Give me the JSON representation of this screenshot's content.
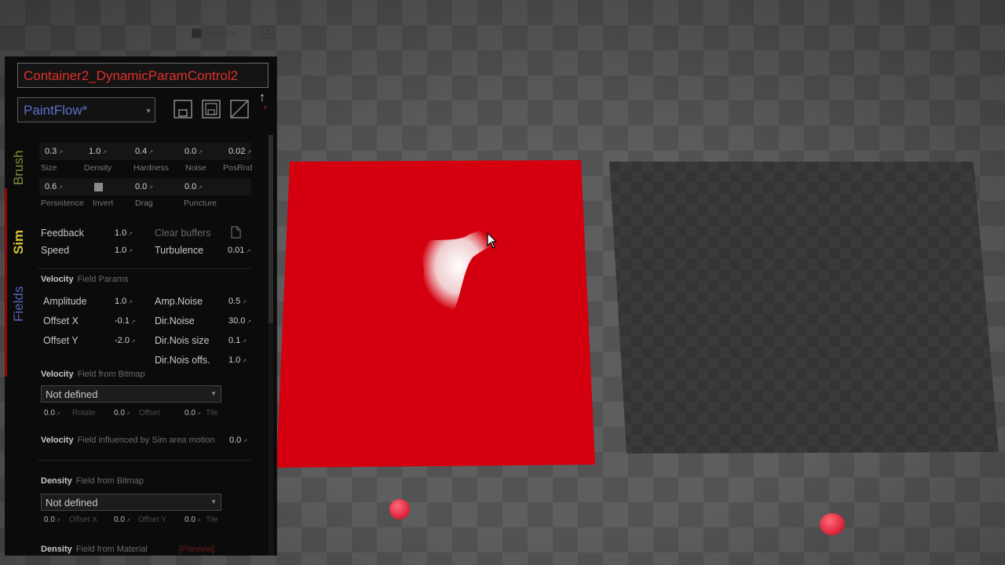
{
  "toolbar": {
    "v_label": "V",
    "tooltips_label": "Tooltips",
    "close_label": "X"
  },
  "panel": {
    "title": "Container2_DynamicParamControl2",
    "preset": "PaintFlow*",
    "tabs": {
      "brush": "Brush",
      "sim": "Sim",
      "fields": "Fields"
    }
  },
  "brush": {
    "row1": [
      {
        "value": "0.3",
        "label": "Size"
      },
      {
        "value": "1.0",
        "label": "Density"
      },
      {
        "value": "0.4",
        "label": "Hardness"
      },
      {
        "value": "0.0",
        "label": "Noise"
      },
      {
        "value": "0.02",
        "label": "PosRnd"
      }
    ],
    "row2": [
      {
        "value": "0.6",
        "label": "Persistence"
      },
      {
        "label": "Invert"
      },
      {
        "value": "0.0",
        "label": "Drag"
      },
      {
        "value": "0.0",
        "label": "Puncture"
      }
    ]
  },
  "sim": {
    "feedback": {
      "label": "Feedback",
      "value": "1.0"
    },
    "speed": {
      "label": "Speed",
      "value": "1.0"
    },
    "clear_buffers": "Clear buffers",
    "turbulence": {
      "label": "Turbulence",
      "value": "0.01"
    }
  },
  "velocity_params": {
    "title": "Velocity",
    "subtitle": "Field Params",
    "amplitude": {
      "label": "Amplitude",
      "value": "1.0"
    },
    "offset_x": {
      "label": "Offset X",
      "value": "-0.1"
    },
    "offset_y": {
      "label": "Offset Y",
      "value": "-2.0"
    },
    "amp_noise": {
      "label": "Amp.Noise",
      "value": "0.5"
    },
    "dir_noise": {
      "label": "Dir.Noise",
      "value": "30.0"
    },
    "dir_noise_size": {
      "label": "Dir.Nois size",
      "value": "0.1"
    },
    "dir_noise_offs": {
      "label": "Dir.Nois offs.",
      "value": "1.0"
    }
  },
  "velocity_bitmap": {
    "title": "Velocity",
    "subtitle": "Field from Bitmap",
    "dropdown": "Not defined",
    "rotate": {
      "value": "0.0",
      "label": "Rotate"
    },
    "offset": {
      "value": "0.0",
      "label": "Offset"
    },
    "tile": {
      "value": "0.0",
      "label": "Tile"
    }
  },
  "velocity_motion": {
    "title": "Velocity",
    "subtitle": "Field influenced by Sim area motion",
    "value": "0.0"
  },
  "density_bitmap": {
    "title": "Density",
    "subtitle": "Field from Bitmap",
    "dropdown": "Not defined",
    "offset_x": {
      "value": "0.0",
      "label": "Offset X"
    },
    "offset_y": {
      "value": "0.0",
      "label": "Offset Y"
    },
    "tile": {
      "value": "0.0",
      "label": "Tile"
    }
  },
  "density_material": {
    "title": "Density",
    "subtitle": "Field from Material",
    "tag": "[Preview]"
  },
  "icons": {
    "save": "save-icon",
    "save_as": "save-as-icon",
    "clear": "clear-icon",
    "up": "arrow-up-icon",
    "doc": "document-icon",
    "cursor": "mouse-cursor-icon"
  },
  "colors": {
    "accent_red": "#e0302a",
    "plane_red": "#d4000f",
    "preset_blue": "#5a70c8",
    "sim_yellow": "#d8c436",
    "brush_green": "#7a8f3a",
    "fields_blue": "#5b5fb8"
  }
}
